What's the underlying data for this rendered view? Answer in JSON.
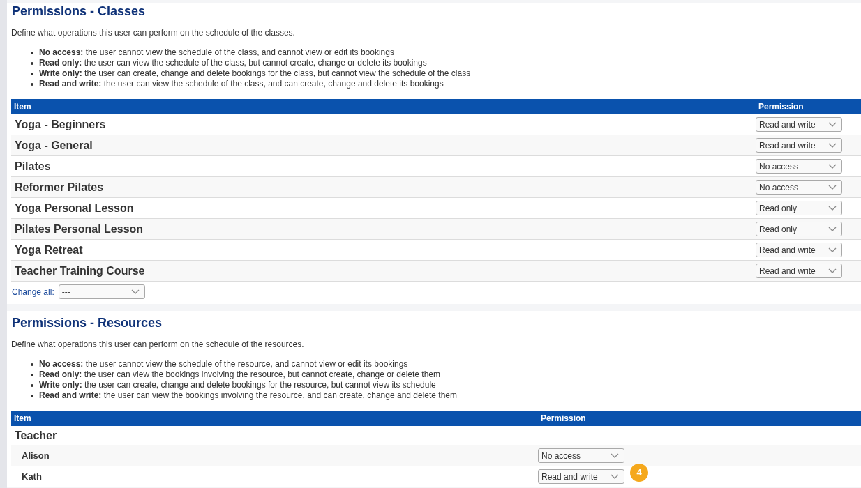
{
  "classes": {
    "title": "Permissions - Classes",
    "description": "Define what operations this user can perform on the schedule of the classes.",
    "legend": [
      "**No access:** the user cannot view the schedule of the class, and cannot view or edit its bookings",
      "**Read only:** the user can view the schedule of the class, but cannot create, change or delete its bookings",
      "**Write only:** the user can create, change and delete bookings for the class, but cannot view the schedule of the class",
      "**Read and write:** the user can view the schedule of the class, and can create, change and delete its bookings"
    ],
    "table": {
      "columns": [
        "Item",
        "Permission"
      ],
      "rows": [
        {
          "item": "Yoga - Beginners",
          "permission": "Read and write"
        },
        {
          "item": "Yoga - General",
          "permission": "Read and write"
        },
        {
          "item": "Pilates",
          "permission": "No access"
        },
        {
          "item": "Reformer Pilates",
          "permission": "No access"
        },
        {
          "item": "Yoga Personal Lesson",
          "permission": "Read only"
        },
        {
          "item": "Pilates Personal Lesson",
          "permission": "Read only"
        },
        {
          "item": "Yoga Retreat",
          "permission": "Read and write"
        },
        {
          "item": "Teacher Training Course",
          "permission": "Read and write"
        }
      ]
    },
    "change_all": {
      "label": "Change all:",
      "value": "---"
    }
  },
  "resources": {
    "title": "Permissions - Resources",
    "description": "Define what operations this user can perform on the schedule of the resources.",
    "legend": [
      "**No access:** the user cannot view the schedule of the resource, and cannot view or edit its bookings",
      "**Read only:** the user can view the bookings involving the resource, but cannot create, change or delete them",
      "**Write only:** the user can create, change and delete bookings for the resource, but cannot view its schedule",
      "**Read and write:** the user can view the bookings involving the resource, and can create, change and delete them"
    ],
    "table": {
      "columns": [
        "Item",
        "Permission"
      ],
      "rows": [
        {
          "item": "Teacher",
          "children": [
            {
              "item": "Alison",
              "permission": "No access"
            },
            {
              "item": "Kath",
              "permission": "Read and write",
              "badge": "4"
            }
          ]
        }
      ]
    }
  }
}
